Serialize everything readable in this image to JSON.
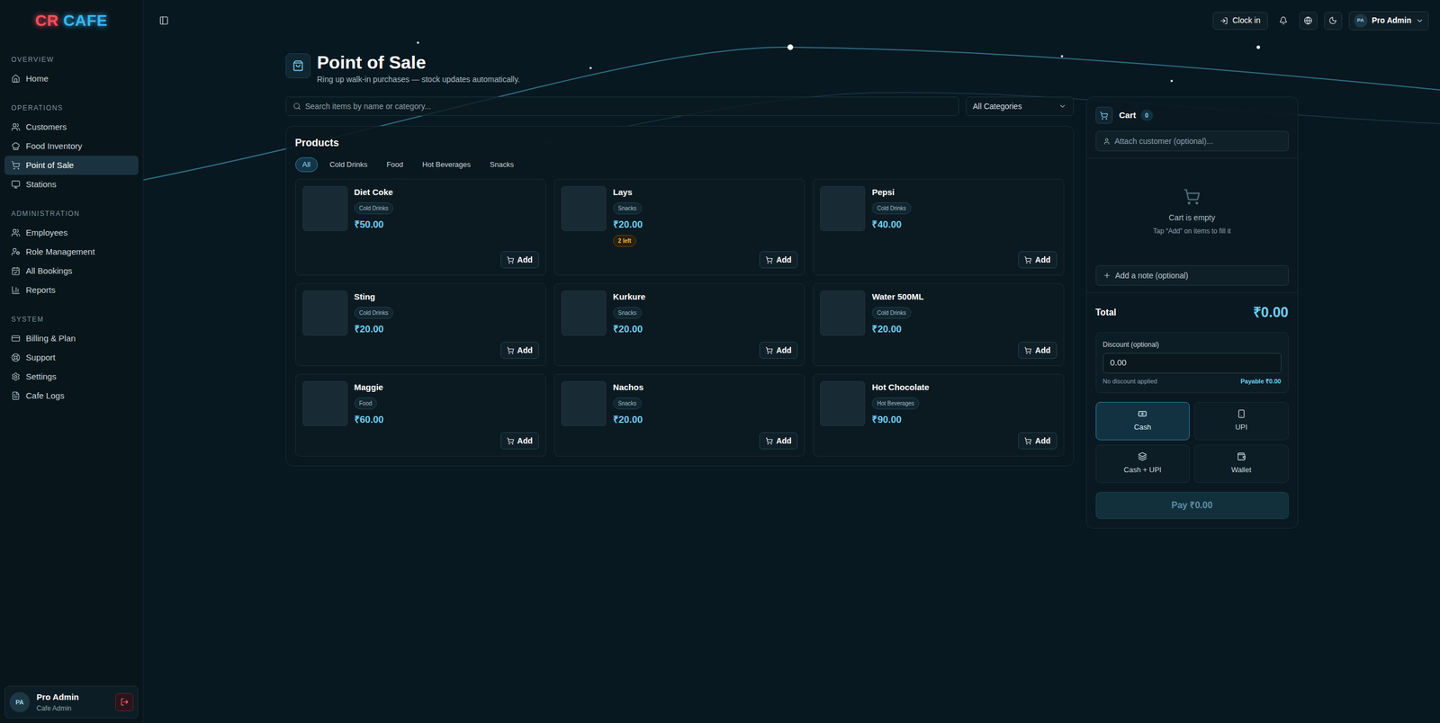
{
  "logo": [
    {
      "text": "CR",
      "color": "#ff4d5e"
    },
    {
      "text": "CAFE",
      "color": "#35b8f5"
    }
  ],
  "sidebar": {
    "sections": [
      {
        "label": "OVERVIEW",
        "items": [
          {
            "label": "Home",
            "selected": false
          }
        ]
      },
      {
        "label": "OPERATIONS",
        "items": [
          {
            "label": "Customers",
            "selected": false
          },
          {
            "label": "Food Inventory",
            "selected": false
          },
          {
            "label": "Point of Sale",
            "selected": true
          },
          {
            "label": "Stations",
            "selected": false
          }
        ]
      },
      {
        "label": "ADMINISTRATION",
        "items": [
          {
            "label": "Employees",
            "selected": false
          },
          {
            "label": "Role Management",
            "selected": false
          },
          {
            "label": "All Bookings",
            "selected": false
          },
          {
            "label": "Reports",
            "selected": false
          }
        ]
      },
      {
        "label": "SYSTEM",
        "items": [
          {
            "label": "Billing & Plan",
            "selected": false
          },
          {
            "label": "Support",
            "selected": false
          },
          {
            "label": "Settings",
            "selected": false
          },
          {
            "label": "Cafe Logs",
            "selected": false
          }
        ]
      }
    ],
    "user": {
      "initials": "PA",
      "name": "Pro Admin",
      "role": "Cafe Admin"
    }
  },
  "topbar": {
    "clock_in": "Clock in",
    "user": {
      "initials": "PA",
      "name": "Pro Admin"
    }
  },
  "header": {
    "title": "Point of Sale",
    "subtitle": "Ring up walk-in purchases — stock updates automatically."
  },
  "search": {
    "placeholder": "Search items by name or category..."
  },
  "category_select": {
    "value": "All Categories"
  },
  "products": {
    "title": "Products",
    "filters": [
      {
        "label": "All",
        "selected": true
      },
      {
        "label": "Cold Drinks",
        "selected": false
      },
      {
        "label": "Food",
        "selected": false
      },
      {
        "label": "Hot Beverages",
        "selected": false
      },
      {
        "label": "Snacks",
        "selected": false
      }
    ],
    "add_label": "Add",
    "items": [
      {
        "name": "Diet Coke",
        "category": "Cold Drinks",
        "price": "₹50.00"
      },
      {
        "name": "Lays",
        "category": "Snacks",
        "price": "₹20.00",
        "stock_note": "2 left"
      },
      {
        "name": "Pepsi",
        "category": "Cold Drinks",
        "price": "₹40.00"
      },
      {
        "name": "Sting",
        "category": "Cold Drinks",
        "price": "₹20.00"
      },
      {
        "name": "Kurkure",
        "category": "Snacks",
        "price": "₹20.00"
      },
      {
        "name": "Water 500ML",
        "category": "Cold Drinks",
        "price": "₹20.00"
      },
      {
        "name": "Maggie",
        "category": "Food",
        "price": "₹60.00"
      },
      {
        "name": "Nachos",
        "category": "Snacks",
        "price": "₹20.00"
      },
      {
        "name": "Hot Chocolate",
        "category": "Hot Beverages",
        "price": "₹90.00"
      }
    ]
  },
  "cart": {
    "title": "Cart",
    "count": "0",
    "customer_placeholder": "Attach customer (optional)...",
    "empty_title": "Cart is empty",
    "empty_hint": "Tap “Add” on items to fill it",
    "note_label": "Add a note (optional)",
    "total_label": "Total",
    "total": "₹0.00",
    "discount_label": "Discount (optional)",
    "discount_placeholder": "0.00",
    "discount_status": "No discount applied",
    "payable": "Payable ₹0.00",
    "payment_methods": [
      {
        "label": "Cash",
        "selected": true
      },
      {
        "label": "UPI",
        "selected": false
      },
      {
        "label": "Cash + UPI",
        "selected": false
      },
      {
        "label": "Wallet",
        "selected": false
      }
    ],
    "pay_label": "Pay ₹0.00",
    "pay_disabled": true
  }
}
